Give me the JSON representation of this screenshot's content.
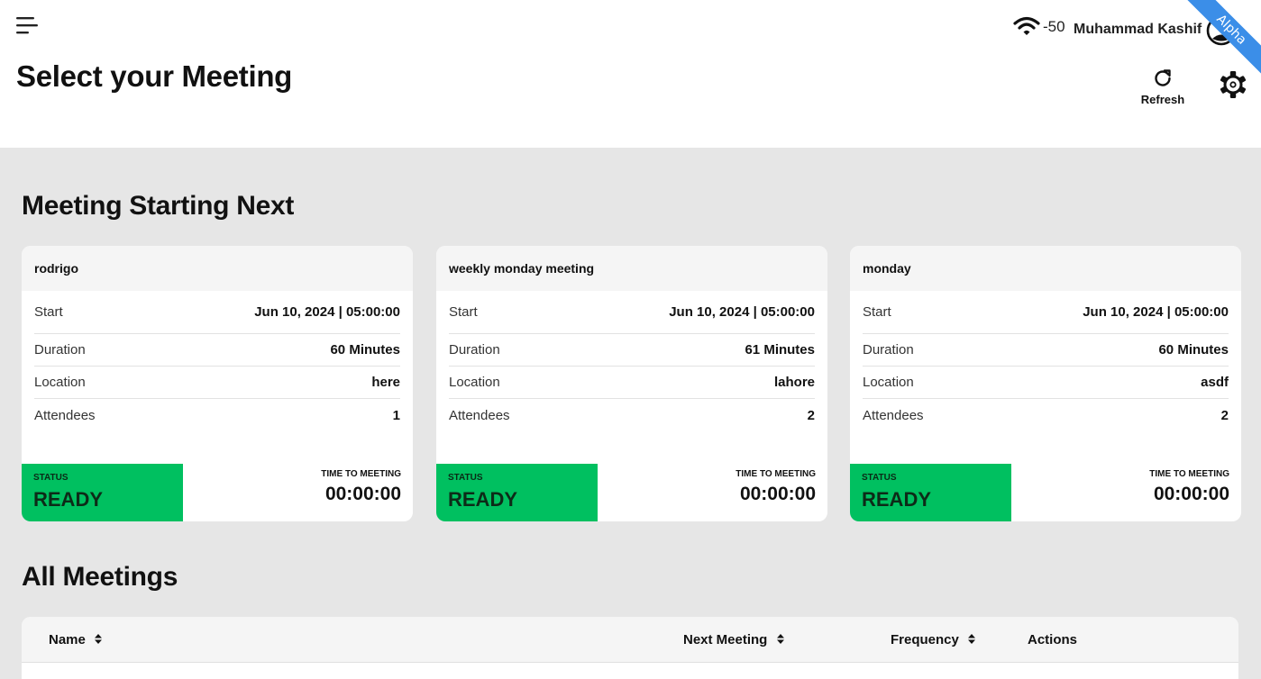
{
  "header": {
    "title": "Select your Meeting",
    "signal_value": "-50",
    "user_name": "Muhammad Kashif",
    "ribbon": "Alpha",
    "refresh_label": "Refresh"
  },
  "sections": {
    "next_title": "Meeting Starting Next",
    "all_title": "All Meetings"
  },
  "labels": {
    "start": "Start",
    "duration": "Duration",
    "location": "Location",
    "attendees": "Attendees",
    "status_caption": "STATUS",
    "time_caption": "TIME TO MEETING"
  },
  "cards": [
    {
      "name": "rodrigo",
      "start": "Jun 10, 2024 | 05:00:00",
      "duration": "60 Minutes",
      "location": "here",
      "attendees": "1",
      "status": "READY",
      "time_to_meeting": "00:00:00"
    },
    {
      "name": "weekly monday meeting",
      "start": "Jun 10, 2024 | 05:00:00",
      "duration": "61 Minutes",
      "location": "lahore",
      "attendees": "2",
      "status": "READY",
      "time_to_meeting": "00:00:00"
    },
    {
      "name": "monday",
      "start": "Jun 10, 2024 | 05:00:00",
      "duration": "60 Minutes",
      "location": "asdf",
      "attendees": "2",
      "status": "READY",
      "time_to_meeting": "00:00:00"
    }
  ],
  "table": {
    "columns": [
      "Name",
      "Next Meeting",
      "Frequency",
      "Actions"
    ]
  },
  "colors": {
    "status_ready": "#00c060",
    "ribbon": "#3b8ee8",
    "page_bg": "#e6e6e6"
  },
  "icons": [
    "menu-icon",
    "wifi-icon",
    "user-avatar-icon",
    "refresh-icon",
    "gear-icon",
    "sort-icon"
  ]
}
